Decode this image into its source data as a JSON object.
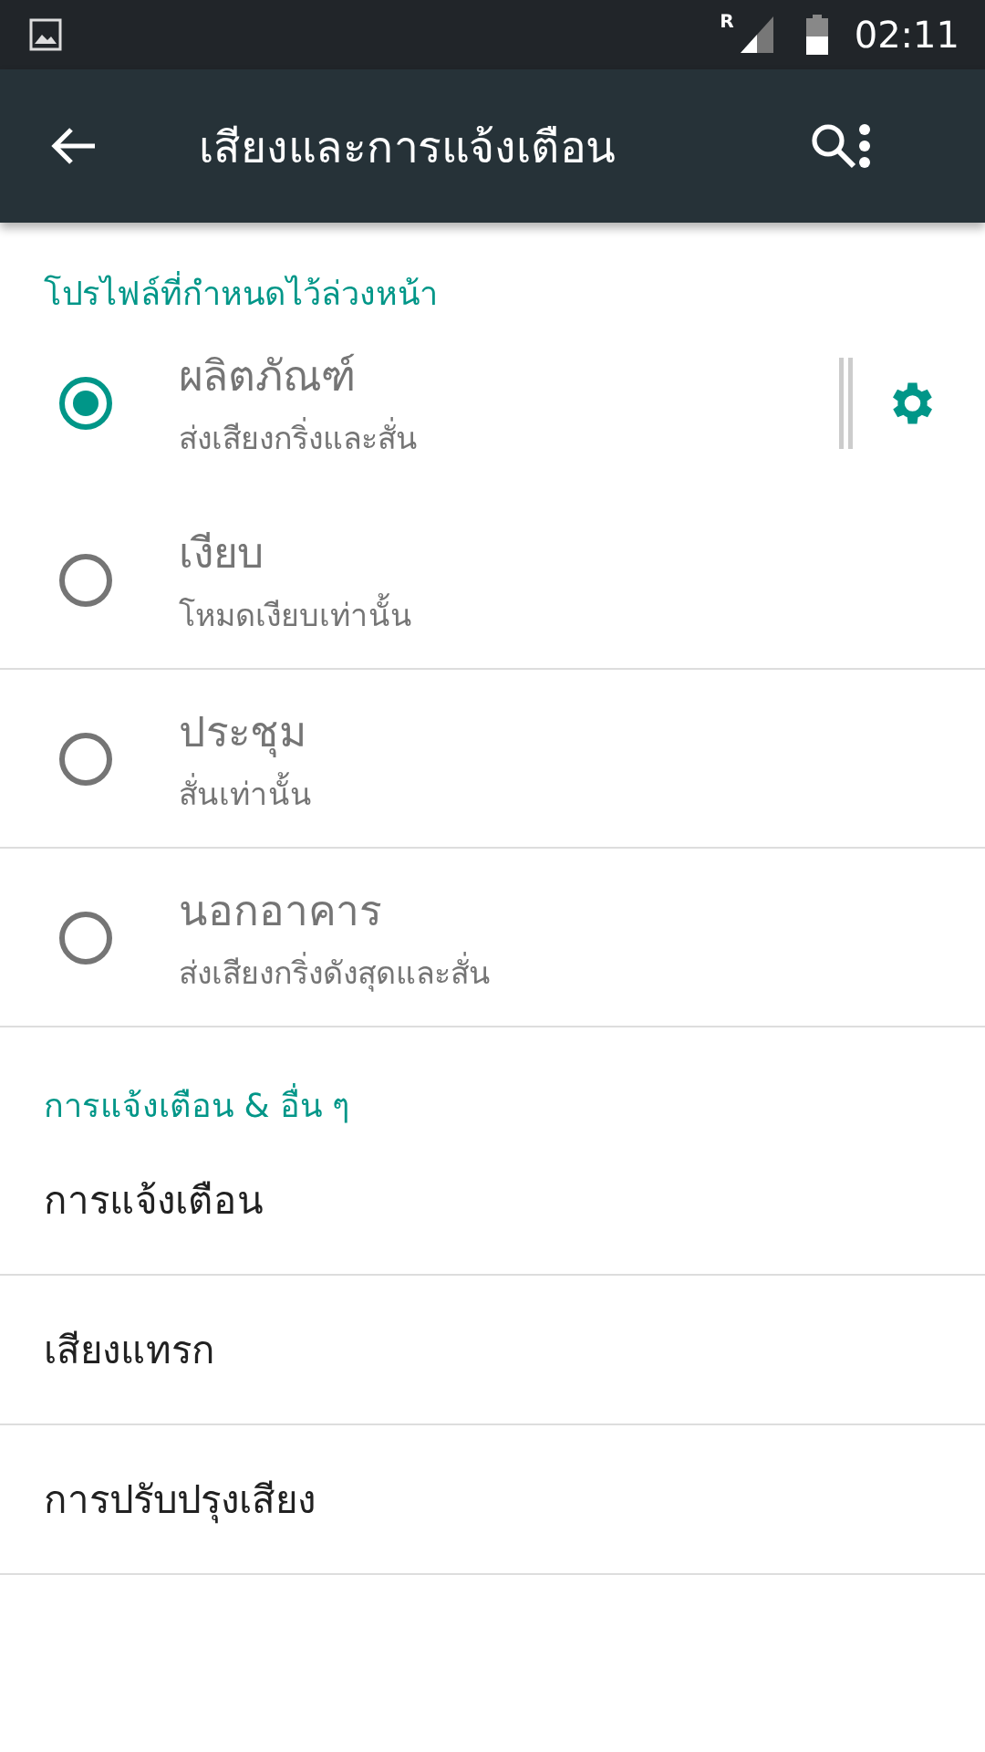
{
  "status_bar": {
    "roaming": "R",
    "time": "02:11"
  },
  "toolbar": {
    "title": "เสียงและการแจ้งเตือน"
  },
  "profiles": {
    "header": "โปรไฟล์ที่กำหนดไว้ล่วงหน้า",
    "items": [
      {
        "title": "ผลิตภัณฑ์",
        "subtitle": "ส่งเสียงกริ่งและสั่น",
        "selected": true,
        "settings": true
      },
      {
        "title": "เงียบ",
        "subtitle": "โหมดเงียบเท่านั้น",
        "selected": false,
        "settings": false
      },
      {
        "title": "ประชุม",
        "subtitle": "สั่นเท่านั้น",
        "selected": false,
        "settings": false
      },
      {
        "title": "นอกอาคาร",
        "subtitle": "ส่งเสียงกริ่งดังสุดและสั่น",
        "selected": false,
        "settings": false
      }
    ]
  },
  "other": {
    "header": "การแจ้งเตือน & อื่น ๆ",
    "items": [
      "การแจ้งเตือน",
      "เสียงแทรก",
      "การปรับปรุงเสียง"
    ]
  }
}
